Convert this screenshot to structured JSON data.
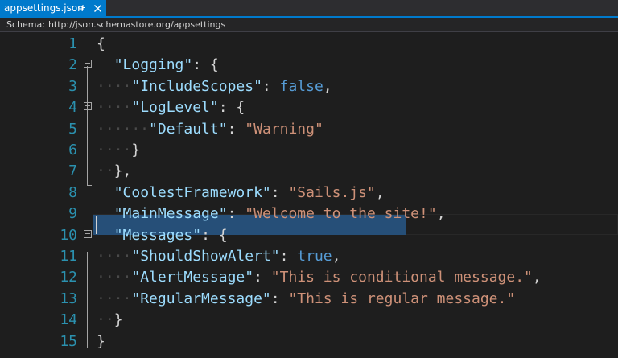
{
  "tab": {
    "filename": "appsettings.json"
  },
  "schema": {
    "label": "Schema:",
    "url": "http://json.schemastore.org/appsettings"
  },
  "lines": [
    {
      "n": "1",
      "tokens": [
        [
          "punc",
          "{"
        ]
      ]
    },
    {
      "n": "2",
      "tokens": [
        [
          "guide",
          "  "
        ],
        [
          "key",
          "\"Logging\""
        ],
        [
          "punc",
          ": {"
        ]
      ]
    },
    {
      "n": "3",
      "tokens": [
        [
          "guide",
          "····"
        ],
        [
          "key",
          "\"IncludeScopes\""
        ],
        [
          "punc",
          ": "
        ],
        [
          "kw",
          "false"
        ],
        [
          "punc",
          ","
        ]
      ]
    },
    {
      "n": "4",
      "tokens": [
        [
          "guide",
          "····"
        ],
        [
          "key",
          "\"LogLevel\""
        ],
        [
          "punc",
          ": {"
        ]
      ]
    },
    {
      "n": "5",
      "tokens": [
        [
          "guide",
          "······"
        ],
        [
          "key",
          "\"Default\""
        ],
        [
          "punc",
          ": "
        ],
        [
          "str",
          "\"Warning\""
        ]
      ]
    },
    {
      "n": "6",
      "tokens": [
        [
          "guide",
          "····"
        ],
        [
          "punc",
          "}"
        ]
      ]
    },
    {
      "n": "7",
      "tokens": [
        [
          "guide",
          "··"
        ],
        [
          "punc",
          "},"
        ]
      ]
    },
    {
      "n": "8",
      "tokens": [
        [
          "guide",
          "  "
        ],
        [
          "key",
          "\"CoolestFramework\""
        ],
        [
          "punc",
          ": "
        ],
        [
          "str",
          "\"Sails.js\""
        ],
        [
          "punc",
          ","
        ]
      ]
    },
    {
      "n": "9",
      "tokens": [
        [
          "guide",
          "  "
        ],
        [
          "key",
          "\"MainMessage\""
        ],
        [
          "punc",
          ": "
        ],
        [
          "str",
          "\"Welcome to the site!\""
        ],
        [
          "punc",
          ","
        ]
      ]
    },
    {
      "n": "10",
      "tokens": [
        [
          "guide",
          "  "
        ],
        [
          "key",
          "\"Messages\""
        ],
        [
          "punc",
          ": {"
        ]
      ]
    },
    {
      "n": "11",
      "tokens": [
        [
          "guide",
          "····"
        ],
        [
          "key",
          "\"ShouldShowAlert\""
        ],
        [
          "punc",
          ": "
        ],
        [
          "kw",
          "true"
        ],
        [
          "punc",
          ","
        ]
      ]
    },
    {
      "n": "12",
      "tokens": [
        [
          "guide",
          "····"
        ],
        [
          "key",
          "\"AlertMessage\""
        ],
        [
          "punc",
          ": "
        ],
        [
          "str",
          "\"This is conditional message.\""
        ],
        [
          "punc",
          ","
        ]
      ]
    },
    {
      "n": "13",
      "tokens": [
        [
          "guide",
          "····"
        ],
        [
          "key",
          "\"RegularMessage\""
        ],
        [
          "punc",
          ": "
        ],
        [
          "str",
          "\"This is regular message.\""
        ]
      ]
    },
    {
      "n": "14",
      "tokens": [
        [
          "guide",
          "··"
        ],
        [
          "punc",
          "}"
        ]
      ]
    },
    {
      "n": "15",
      "tokens": [
        [
          "punc",
          "}"
        ]
      ]
    }
  ],
  "colors": {
    "accent": "#007acc",
    "key": "#9cdcfe",
    "string": "#ce9178",
    "keyword": "#569cd6",
    "line_number": "#2b91af",
    "selection": "#264f78"
  }
}
